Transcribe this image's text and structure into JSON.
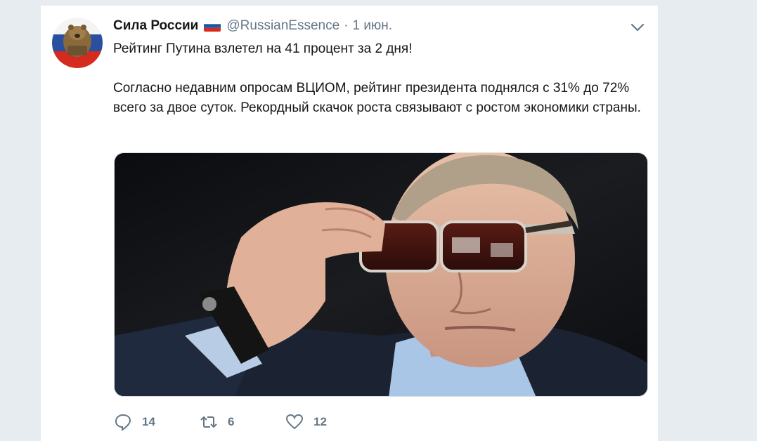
{
  "tweet": {
    "display_name": "Сила России",
    "handle": "@RussianEssence",
    "separator": "·",
    "time": "1 июн.",
    "headline": "Рейтинг Путина взлетел на 41 процент за 2 дня!",
    "body": "Согласно недавним опросам ВЦИОМ, рейтинг президента поднялся с 31% до 72% всего за двое суток. Рекордный скачок роста связывают с ростом экономики страны.",
    "icons": {
      "avatar": "russian-bear-avatar",
      "flag": "russia-flag",
      "caret": "chevron-down-icon",
      "reply": "reply-icon",
      "retweet": "retweet-icon",
      "like": "heart-icon"
    },
    "actions": {
      "reply_count": "14",
      "retweet_count": "6",
      "like_count": "12"
    }
  },
  "colors": {
    "background": "#e6ecf0",
    "text_primary": "#14171a",
    "text_secondary": "#657786"
  }
}
